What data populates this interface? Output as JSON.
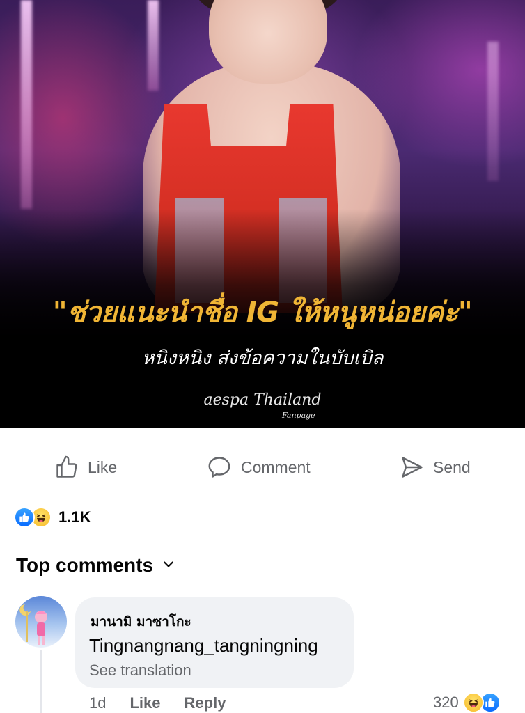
{
  "post": {
    "image": {
      "headline": "\"ช่วยแนะนำชื่อ IG ให้หนูหน่อยค่ะ\"",
      "subline": "หนิงหนิง ส่งข้อความในบับเบิล",
      "watermark": "aespa Thailand",
      "watermark_sub": "Fanpage"
    },
    "actions": {
      "like_label": "Like",
      "comment_label": "Comment",
      "send_label": "Send"
    },
    "reactions": {
      "types": [
        "like",
        "haha"
      ],
      "count": "1.1K"
    }
  },
  "comments_section": {
    "header": "Top comments",
    "comments": [
      {
        "author": "มานามิ มาซาโกะ",
        "text": "Tingnangnang_tangningning",
        "see_translation": "See translation",
        "time": "1d",
        "like_label": "Like",
        "reply_label": "Reply",
        "reaction_count": "320",
        "reaction_types": [
          "haha",
          "like"
        ]
      }
    ]
  },
  "colors": {
    "accent_blue": "#0a6cff",
    "muted_text": "#65676b",
    "headline_gold": "#f0b535",
    "bubble_bg": "#f0f2f5"
  }
}
